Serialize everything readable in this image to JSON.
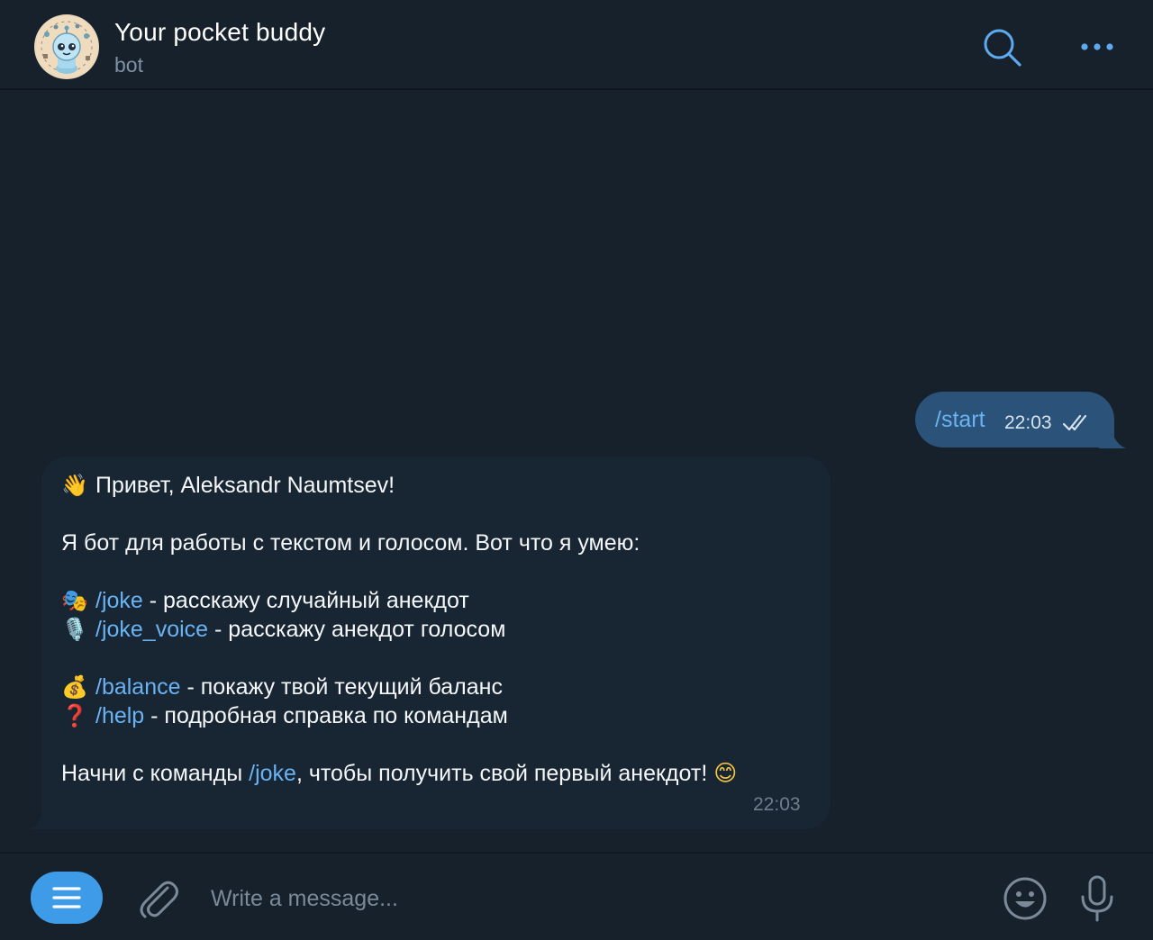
{
  "header": {
    "title": "Your pocket buddy",
    "subtitle": "bot"
  },
  "colors": {
    "background": "#17212b",
    "incoming_bubble": "#182533",
    "outgoing_bubble": "#2b5278",
    "link": "#6ab3f3",
    "accent": "#3e9be8"
  },
  "messages": {
    "outgoing": {
      "text": "/start",
      "time": "22:03",
      "status_icon": "double-check-icon"
    },
    "incoming": {
      "greeting_emoji": "👋",
      "greeting": "Привет, Aleksandr Naumtsev!",
      "intro": "Я бот для работы с текстом и голосом. Вот что я умею:",
      "commands": [
        {
          "emoji": "🎭",
          "command": "/joke",
          "description": " - расскажу случайный анекдот"
        },
        {
          "emoji": "🎙️",
          "command": "/joke_voice",
          "description": " - расскажу анекдот голосом"
        },
        {
          "emoji": "💰",
          "command": "/balance",
          "description": " - покажу твой текущий баланс"
        },
        {
          "emoji": "❓",
          "command": "/help",
          "description": " - подробная справка по командам"
        }
      ],
      "outro_before": "Начни с команды ",
      "outro_command": "/joke",
      "outro_after": ", чтобы получить свой первый анекдот! ",
      "outro_emoji": "😊",
      "time": "22:03"
    }
  },
  "composer": {
    "placeholder": "Write a message..."
  }
}
